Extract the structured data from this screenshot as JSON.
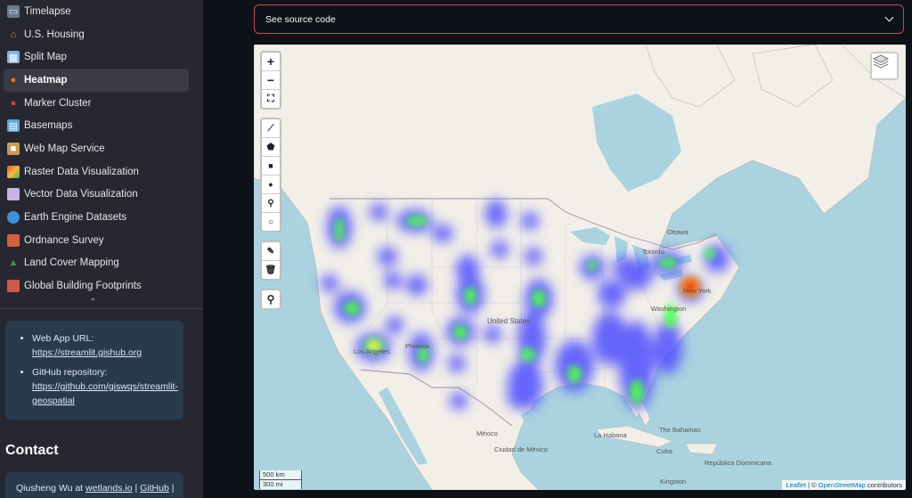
{
  "sidebar": {
    "items": [
      {
        "label": "Timelapse",
        "icon": "camera-icon",
        "active": false
      },
      {
        "label": "U.S. Housing",
        "icon": "house-icon",
        "active": false
      },
      {
        "label": "Split Map",
        "icon": "split-map-icon",
        "active": false
      },
      {
        "label": "Heatmap",
        "icon": "fire-icon",
        "active": true
      },
      {
        "label": "Marker Cluster",
        "icon": "pin-icon",
        "active": false
      },
      {
        "label": "Basemaps",
        "icon": "map-icon",
        "active": false
      },
      {
        "label": "Web Map Service",
        "icon": "package-icon",
        "active": false
      },
      {
        "label": "Raster Data Visualization",
        "icon": "raster-icon",
        "active": false
      },
      {
        "label": "Vector Data Visualization",
        "icon": "vector-icon",
        "active": false
      },
      {
        "label": "Earth Engine Datasets",
        "icon": "globe-icon",
        "active": false
      },
      {
        "label": "Ordnance Survey",
        "icon": "brick-icon",
        "active": false
      },
      {
        "label": "Land Cover Mapping",
        "icon": "tree-icon",
        "active": false
      },
      {
        "label": "Global Building Footprints",
        "icon": "building-icon",
        "active": false
      }
    ],
    "info": {
      "webapp_label": "Web App URL:",
      "webapp_url": "https://streamlit.gishub.org",
      "github_label": "GitHub repository:",
      "github_url_1": "https://github.com/giswqs/streamlit-",
      "github_url_2": "geospatial"
    },
    "contact_title": "Contact",
    "contact_text": "Qiusheng Wu at",
    "contact_link1": "wetlands.io",
    "contact_sep": "|",
    "contact_link2": "GitHub",
    "contact_end": "|"
  },
  "expander": {
    "label": "See source code"
  },
  "map": {
    "zoom_in": "+",
    "zoom_out": "−",
    "scale_km": "500 km",
    "scale_mi": "300 mi",
    "attribution_leaflet": "Leaflet",
    "attribution_sep": "| ©",
    "attribution_osm": "OpenStreetMap",
    "attribution_tail": "contributors",
    "labels": {
      "ottawa": "Ottawa",
      "toronto": "Toronto",
      "new_york": "New York",
      "washington": "Washington",
      "united_states": "United States",
      "los_angeles": "Los Angeles",
      "phoenix": "Phoenix",
      "mexico": "México",
      "la_habana": "La Habana",
      "bahamas": "The Bahamas",
      "cuba": "Cuba",
      "republica_dominicana": "República Dominicana",
      "ciudad_de_mexico": "Ciudad de México",
      "kingston": "Kingston"
    },
    "colors": {
      "water": "#aad3df",
      "land": "#f2efe9",
      "heat_low": "#4d4dff",
      "heat_mid": "#4dff4d",
      "heat_high": "#ff2200"
    }
  }
}
